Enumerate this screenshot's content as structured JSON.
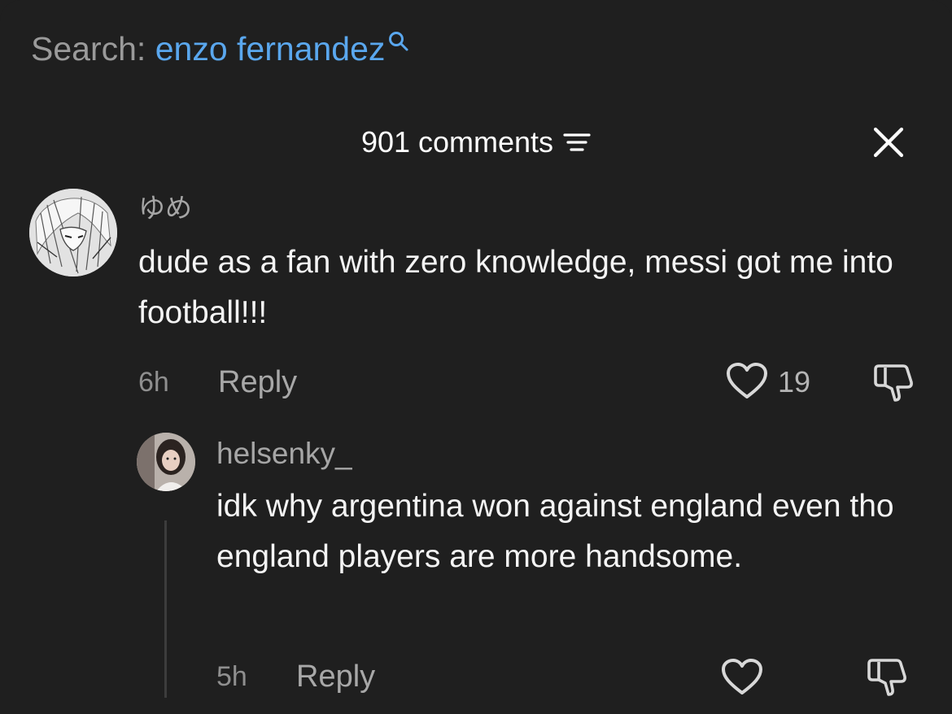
{
  "search": {
    "prefix": "Search:",
    "query": "enzo fernandez",
    "icon": "search-icon"
  },
  "header": {
    "comments_count": "901 comments",
    "sort_icon": "sort-icon",
    "close_icon": "close-icon"
  },
  "comments": [
    {
      "username": "ゆめ",
      "text": "dude as a fan with zero knowledge, messi got me into football!!!",
      "time": "6h",
      "reply_label": "Reply",
      "likes": "19"
    }
  ],
  "replies": [
    {
      "username": "helsenky_",
      "text": "idk why argentina won against england even tho england players are more handsome.",
      "time": "5h",
      "reply_label": "Reply"
    }
  ],
  "colors": {
    "background": "#1f1f1f",
    "link_blue": "#5aa7ee",
    "muted_text": "#a6a6a6",
    "primary_text": "#f4f4f4"
  }
}
